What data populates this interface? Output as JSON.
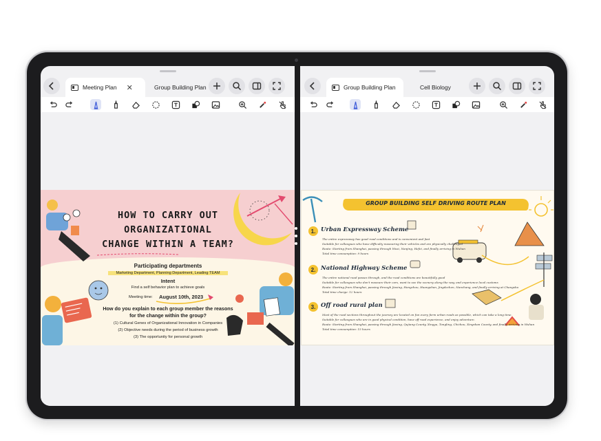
{
  "left_pane": {
    "tabs": [
      {
        "label": "Meeting Plan",
        "active": true
      },
      {
        "label": "Group Building Plan",
        "active": false
      }
    ],
    "slide": {
      "title_lines": [
        "HOW TO CARRY OUT",
        "ORGANIZATIONAL",
        "CHANGE WITHIN A TEAM?"
      ],
      "participating_heading": "Participating departments",
      "participating_value": "Marketing Department, Planning Department, Leading TEAM",
      "intent_heading": "Intent",
      "intent_value": "Find a self behavior plan to achieve goals",
      "meeting_time_label": "Meeting time:",
      "meeting_time_value": "August 10th, 2023",
      "question_line1": "How do you explain to each group member the reasons",
      "question_line2": "for the change within the group?",
      "points": [
        "(1) Cultural Genes of Organizational Innovation in Companies",
        "(2) Objective needs during the period of business growth",
        "(3) The opportunity for personal growth"
      ]
    }
  },
  "right_pane": {
    "tabs": [
      {
        "label": "Group Building Plan",
        "active": true
      },
      {
        "label": "Cell Biology",
        "active": false
      }
    ],
    "slide": {
      "title": "GROUP BUILDING SELF DRIVING ROUTE PLAN",
      "sections": [
        {
          "number": "1.",
          "heading": "Urban Expressway Scheme",
          "bullets": [
            "The entire expressway has good road conditions and is convenient and fast",
            "Suitable for colleagues who have difficulty measuring their vehicles and are physically challenged",
            "Route: Starting from Shanghai, passing through Wuxi, Nanjing, Hefei, and finally arriving in Wuhan",
            "Total time consumption: 9 hours"
          ]
        },
        {
          "number": "2.",
          "heading": "National Highway Scheme",
          "bullets": [
            "The entire national road passes through, and the road conditions are beautifully good",
            "Suitable for colleagues who don't measure their cars, want to see the scenery along the way, and experience local customs",
            "Route: Starting from Shanghai, passing through Jiaxing, Hangzhou, Huangshan, Jingdezhen, Nanchang, and finally arriving at Changsha",
            "Total time charge: 12 hours"
          ]
        },
        {
          "number": "3.",
          "heading": "Off road rural plan",
          "bullets": [
            "Most of the road sections throughout the journey are located on fun every farm urban roads as possible, which can take a long time.",
            "Suitable for colleagues who are in good physical condition, have off road experience, and enjoy adventure.",
            "Route: Starting from Shanghai, passing through Jiaxing, Qujiang County, Xingyu, Tongling, Chizhou, Xingshan County, and finally arriving in Wuhan",
            "Total time consumption: 15 hours"
          ]
        }
      ]
    }
  },
  "colors": {
    "frame": "#1c1c1e",
    "accent_tool": "#3d5bd9",
    "pink_bg": "#f6cfd0",
    "banner_yellow": "#f4c230"
  }
}
